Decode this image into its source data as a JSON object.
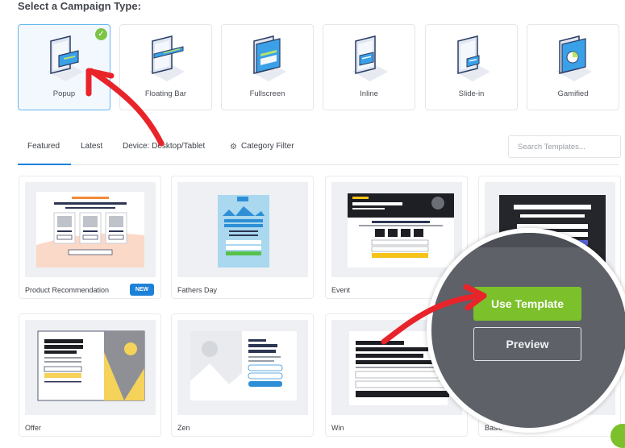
{
  "heading": "Select a Campaign Type:",
  "campaign_types": [
    {
      "label": "Popup",
      "selected": true
    },
    {
      "label": "Floating Bar",
      "selected": false
    },
    {
      "label": "Fullscreen",
      "selected": false
    },
    {
      "label": "Inline",
      "selected": false
    },
    {
      "label": "Slide-in",
      "selected": false
    },
    {
      "label": "Gamified",
      "selected": false
    }
  ],
  "tabs": {
    "featured": "Featured",
    "latest": "Latest",
    "device": "Device: Desktop/Tablet",
    "category_filter": "Category Filter"
  },
  "search": {
    "placeholder": "Search Templates..."
  },
  "templates": [
    {
      "name": "Product Recommendation",
      "badge": "NEW"
    },
    {
      "name": "Fathers Day"
    },
    {
      "name": "Event"
    },
    {
      "name": "Offer"
    },
    {
      "name": "Zen"
    },
    {
      "name": "Win"
    },
    {
      "name": "Basic"
    }
  ],
  "zoom": {
    "use_template": "Use Template",
    "preview": "Preview"
  },
  "colors": {
    "accent_blue": "#1d81d8",
    "accent_green": "#7cc02b",
    "arrow_red": "#e8242a"
  }
}
